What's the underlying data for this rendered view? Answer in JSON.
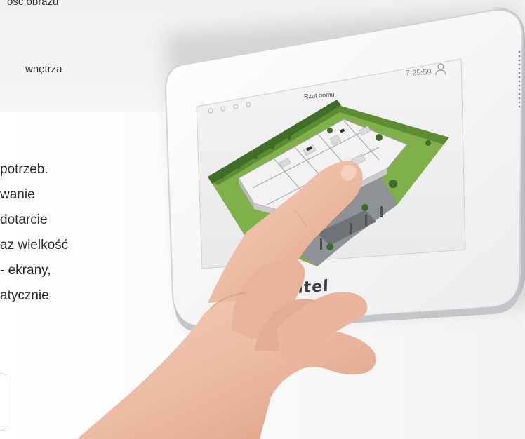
{
  "left_column": {
    "top_fragment": "ość obrazu",
    "interior_fragment": "wnętrza",
    "paragraph_lines": [
      "potrzeb.",
      "wanie",
      "dotarcie",
      "az wielkość",
      "- ekrany,",
      "atycznie"
    ]
  },
  "device": {
    "time": "7:25:59",
    "screen_title": "Rzut domu",
    "brand": "Satel",
    "icons": [
      "user-icon",
      "speaker-grille-icon"
    ]
  },
  "colors": {
    "frame": "#f7f7f8",
    "bezel_edge": "#c9cacd",
    "grass": "#7fb04a",
    "wall_bg": "#f3f3f4"
  }
}
